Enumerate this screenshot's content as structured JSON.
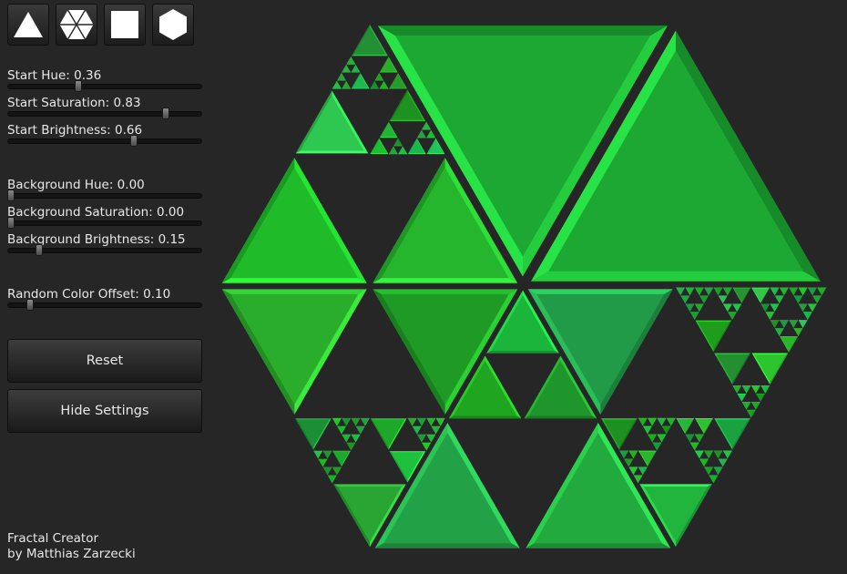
{
  "shape_buttons": [
    {
      "name": "triangle",
      "icon": "triangle-icon"
    },
    {
      "name": "hexagon-triangles",
      "icon": "hexagon-triangles-icon"
    },
    {
      "name": "square",
      "icon": "square-icon"
    },
    {
      "name": "hexagon",
      "icon": "hexagon-icon"
    }
  ],
  "sliders": {
    "start_hue": {
      "label": "Start Hue: 0.36",
      "value": 0.36
    },
    "start_saturation": {
      "label": "Start Saturation: 0.83",
      "value": 0.83
    },
    "start_brightness": {
      "label": "Start Brightness: 0.66",
      "value": 0.66
    },
    "background_hue": {
      "label": "Background Hue: 0.00",
      "value": 0.0
    },
    "background_saturation": {
      "label": "Background Saturation: 0.00",
      "value": 0.0
    },
    "background_brightness": {
      "label": "Background Brightness: 0.15",
      "value": 0.15
    },
    "random_color_offset": {
      "label": "Random Color Offset: 0.10",
      "value": 0.1
    }
  },
  "buttons": {
    "reset": "Reset",
    "hide_settings": "Hide Settings"
  },
  "credits": {
    "line1": "Fractal Creator",
    "line2": "by Matthias Zarzecki"
  },
  "colors": {
    "background": "#262626",
    "accent_green": "#2fb84c"
  }
}
